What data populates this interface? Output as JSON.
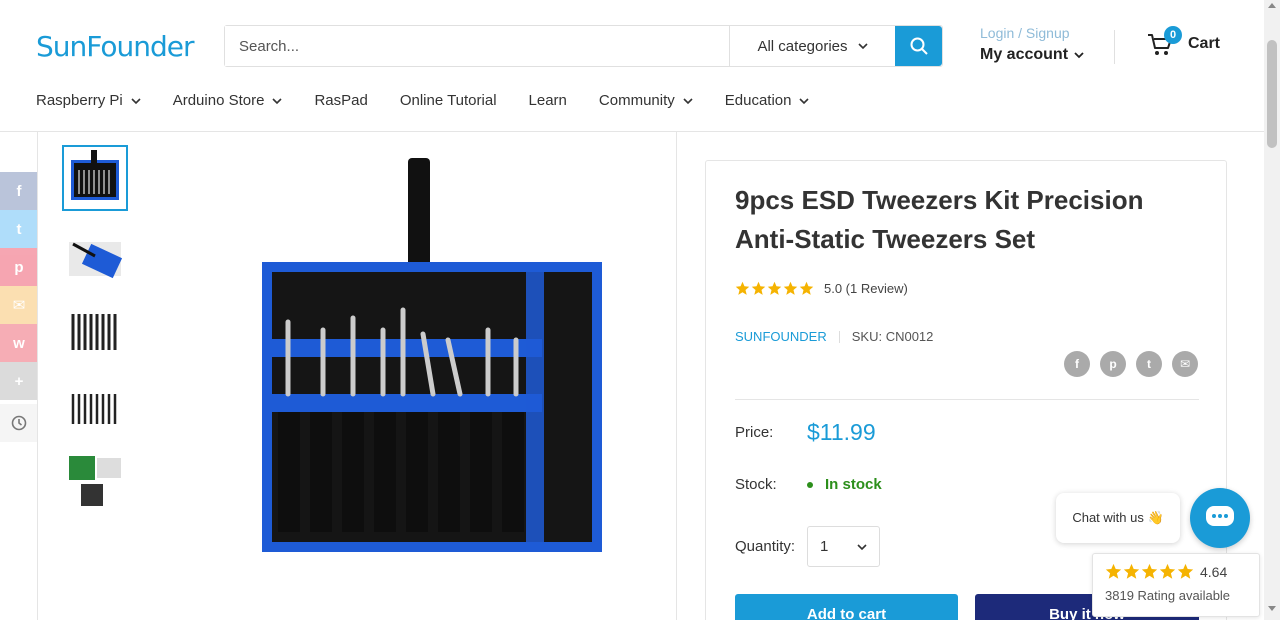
{
  "header": {
    "logo": "SunFounder",
    "search": {
      "placeholder": "Search...",
      "category": "All categories"
    },
    "account": {
      "login": "Login / Signup",
      "my_account": "My account"
    },
    "cart": {
      "count": "0",
      "label": "Cart"
    }
  },
  "nav": [
    {
      "label": "Raspberry Pi",
      "dropdown": true
    },
    {
      "label": "Arduino Store",
      "dropdown": true
    },
    {
      "label": "RasPad",
      "dropdown": false
    },
    {
      "label": "Online Tutorial",
      "dropdown": false
    },
    {
      "label": "Learn",
      "dropdown": false
    },
    {
      "label": "Community",
      "dropdown": true
    },
    {
      "label": "Education",
      "dropdown": true
    }
  ],
  "share_rail": [
    {
      "icon": "facebook-icon",
      "glyph": "f",
      "color": "#3b5998"
    },
    {
      "icon": "twitter-icon",
      "glyph": "t",
      "color": "#1da1f2"
    },
    {
      "icon": "pinterest-icon",
      "glyph": "p",
      "color": "#e60023"
    },
    {
      "icon": "email-icon",
      "glyph": "✉",
      "color": "#f5a623"
    },
    {
      "icon": "weibo-icon",
      "glyph": "w",
      "color": "#e6162d"
    },
    {
      "icon": "more-icon",
      "glyph": "+",
      "color": "#999999"
    }
  ],
  "product": {
    "title": "9pcs ESD Tweezers Kit Precision Anti-Static Tweezers Set",
    "rating_text": "5.0 (1 Review)",
    "rating_value": 5,
    "vendor": "SUNFOUNDER",
    "sku": "SKU: CN0012",
    "price_label": "Price:",
    "price": "$11.99",
    "stock_label": "Stock:",
    "stock": "In stock",
    "quantity_label": "Quantity:",
    "quantity": "1",
    "add_to_cart": "Add to cart",
    "buy_now": "Buy it now"
  },
  "chat": {
    "label": "Chat with us 👋"
  },
  "rating_widget": {
    "score": "4.64",
    "summary": "3819 Rating available",
    "stars": 4.64
  },
  "colors": {
    "accent": "#1a9bd7",
    "buy": "#1d2a7a",
    "stock": "#2c8f1b",
    "star": "#f5b301"
  }
}
